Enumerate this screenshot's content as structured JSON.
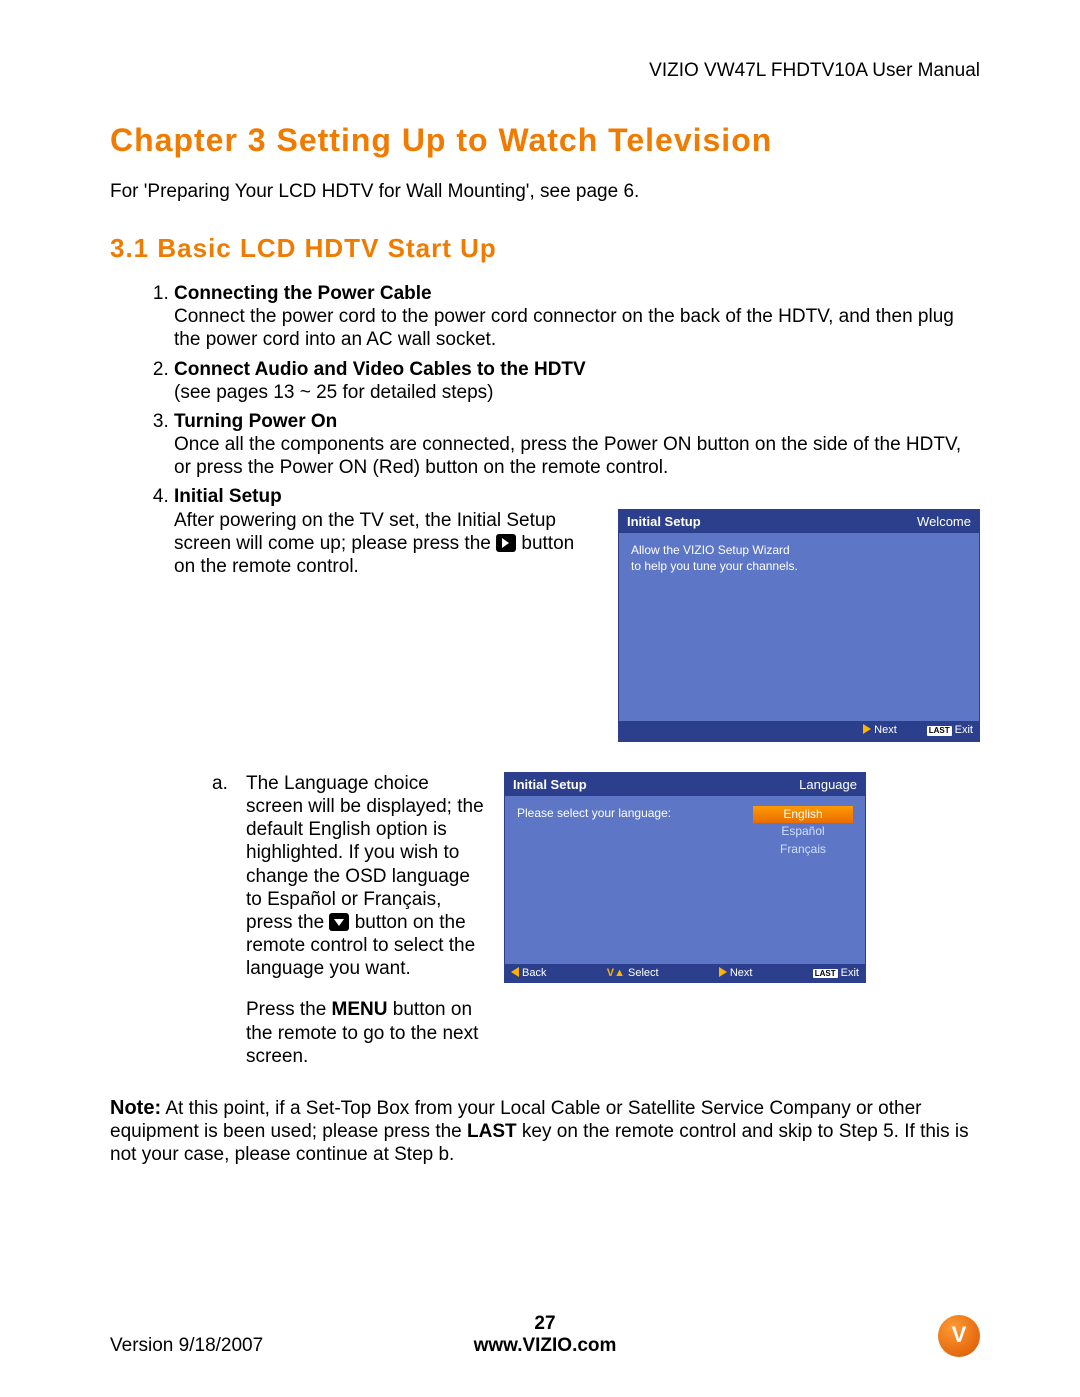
{
  "header": {
    "doc_title": "VIZIO VW47L FHDTV10A User Manual"
  },
  "chapter_title": "Chapter 3  Setting Up to Watch Television",
  "intro": "For 'Preparing Your LCD HDTV for Wall Mounting', see page 6.",
  "section_title": "3.1 Basic LCD HDTV Start Up",
  "items": {
    "i1": {
      "title": "Connecting the Power Cable",
      "body": "Connect the power cord to the power cord connector on the back of the HDTV, and then plug the power cord into an AC wall socket."
    },
    "i2": {
      "title": "Connect Audio and Video Cables to the HDTV",
      "body": "(see pages 13 ~ 25 for detailed steps)"
    },
    "i3": {
      "title": "Turning Power On",
      "body": "Once all the components are connected, press the Power ON button on the side of the HDTV, or press the Power ON (Red) button on the remote control."
    },
    "i4": {
      "title": "Initial Setup",
      "body_a": "After powering on the TV set, the Initial Setup screen will come up; please press the ",
      "body_b": " button on the remote control."
    }
  },
  "osd1": {
    "title": "Initial  Setup",
    "right": "Welcome",
    "line1": "Allow the VIZIO Setup Wizard",
    "line2": "to help you tune your channels.",
    "next": "Next",
    "exit": "Exit",
    "last": "LAST"
  },
  "sub_a": {
    "label": "a.",
    "p1a": "The Language choice screen will be displayed; the default English option is highlighted.  If you wish to change the OSD language to Español or Français, press the ",
    "p1b": " button on the remote control to select the language you want.",
    "p2a": "Press the ",
    "p2b": "MENU",
    "p2c": " button on the remote to go to the next screen."
  },
  "osd2": {
    "title": "Initial  Setup",
    "right": "Language",
    "prompt": "Please select your language:",
    "opt1": "English",
    "opt2": "Español",
    "opt3": "Français",
    "back": "Back",
    "select": "Select",
    "next": "Next",
    "exit": "Exit",
    "last": "LAST"
  },
  "note": {
    "label": "Note:",
    "body_a": "  At this point, if a Set-Top Box from your Local Cable or Satellite Service Company or other equipment is been used; please press the ",
    "body_b": "LAST",
    "body_c": " key on the remote control and skip to Step 5. If this is not your case, please continue at Step b."
  },
  "footer": {
    "version": "Version 9/18/2007",
    "page": "27",
    "url": "www.VIZIO.com"
  }
}
